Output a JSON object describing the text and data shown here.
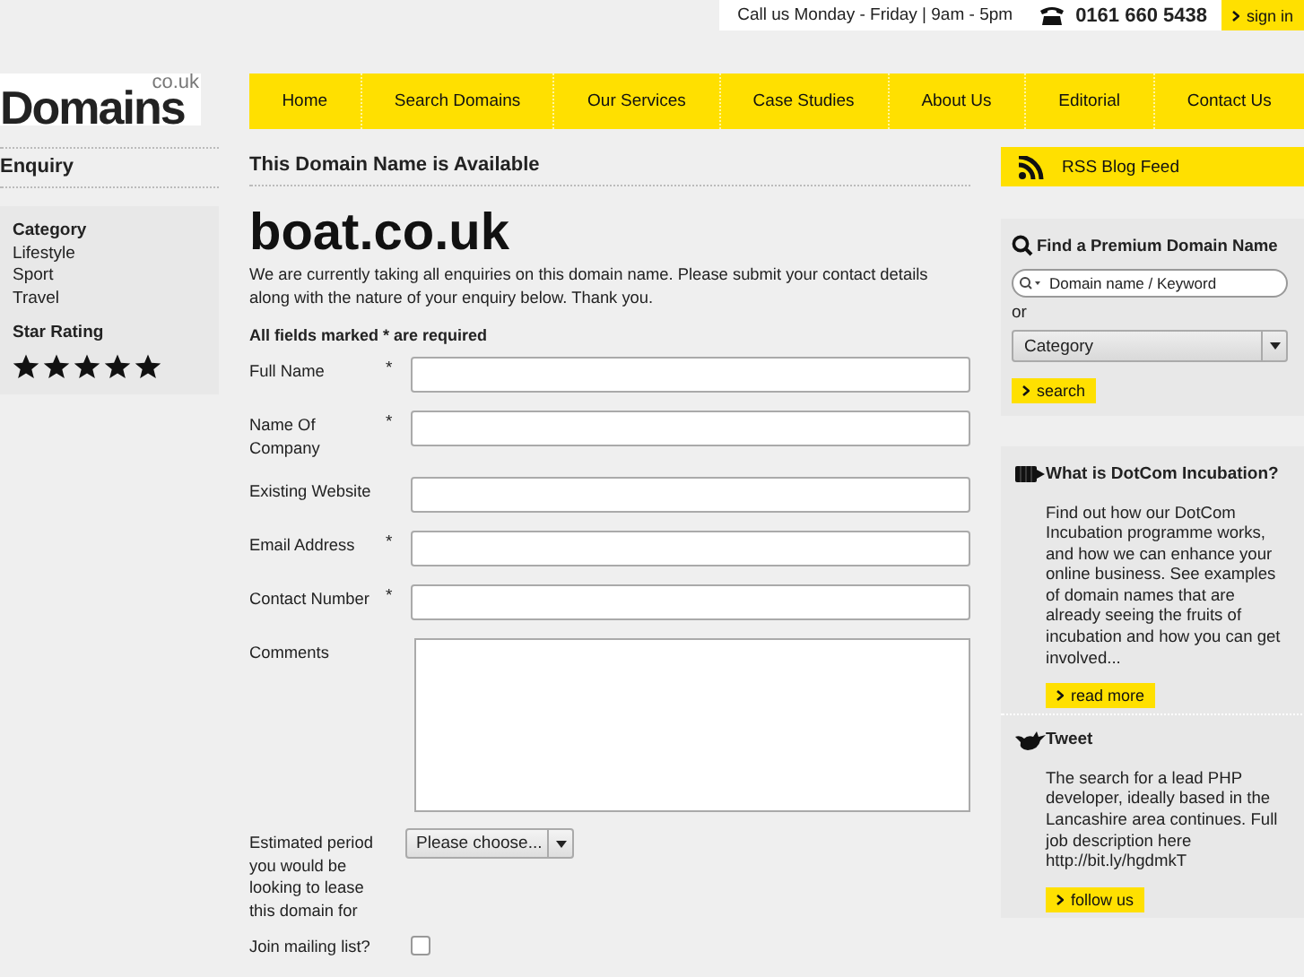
{
  "top_bar": {
    "hours": "Call us Monday - Friday | 9am - 5pm",
    "phone": "0161 660 5438",
    "sign_in": "sign in"
  },
  "logo": {
    "name": "Domains",
    "suffix": "co.uk"
  },
  "nav": [
    {
      "label": "Home"
    },
    {
      "label": "Search Domains"
    },
    {
      "label": "Our Services"
    },
    {
      "label": "Case Studies"
    },
    {
      "label": "About Us"
    },
    {
      "label": "Editorial"
    },
    {
      "label": "Contact Us"
    }
  ],
  "sidebar": {
    "title": "Enquiry",
    "category_heading": "Category",
    "categories": [
      "Lifestyle",
      "Sport",
      "Travel"
    ],
    "rating_heading": "Star Rating",
    "stars": 5
  },
  "main": {
    "heading": "This Domain Name is Available",
    "domain": "boat.co.uk",
    "intro": "We are currently taking all enquiries on this domain name. Please submit your contact details along with the nature of your enquiry below. Thank you.",
    "required_note": "All fields marked * are required",
    "required_marker": "*",
    "fields": [
      {
        "kind": "text",
        "label": "Full Name",
        "required": true
      },
      {
        "kind": "text",
        "label": "Name Of Company",
        "required": true
      },
      {
        "kind": "text",
        "label": "Existing Website",
        "required": false
      },
      {
        "kind": "text",
        "label": "Email Address",
        "required": true
      },
      {
        "kind": "text",
        "label": "Contact Number",
        "required": true
      },
      {
        "kind": "textarea",
        "label": "Comments",
        "required": false
      },
      {
        "kind": "select",
        "label": "Estimated period you would be looking to lease this domain for",
        "required": false,
        "value": "Please choose..."
      },
      {
        "kind": "checkbox",
        "label": "Join mailing list?",
        "required": false,
        "checked": false
      }
    ]
  },
  "right": {
    "rss": "RSS Blog Feed",
    "search_title": "Find a Premium Domain Name",
    "search_placeholder": "Domain name / Keyword",
    "or": "or",
    "category": "Category",
    "search_button": "search",
    "blocks": [
      {
        "kind": "incubation",
        "title": "What is DotCom Incubation?",
        "text": "Find out how our DotCom Incubation programme works, and how we can enhance your online business. See examples of domain names that are already seeing the fruits of incubation and how you can get involved...",
        "button": "read more"
      },
      {
        "kind": "tweet",
        "title": "Tweet",
        "text": "The search for a lead PHP developer, ideally based in the Lancashire area continues. Full job description here http://bit.ly/hgdmkT",
        "button": "follow us"
      }
    ]
  }
}
